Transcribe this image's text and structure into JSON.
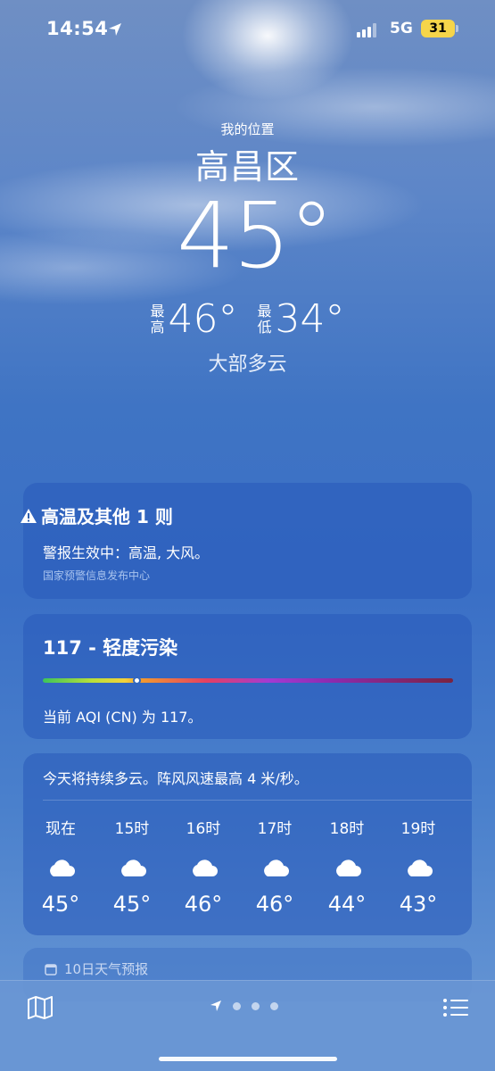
{
  "status_bar": {
    "time": "14:54",
    "network": "5G",
    "battery": "31",
    "battery_color": "#f6d54a",
    "icons": [
      "location-arrow-icon",
      "signal-icon"
    ]
  },
  "header": {
    "my_location": "我的位置",
    "city": "高昌区",
    "temperature": "45°",
    "high_label_1": "最",
    "high_label_2": "高",
    "high": "46°",
    "low_label_1": "最",
    "low_label_2": "低",
    "low": "34°",
    "condition": "大部多云"
  },
  "alert": {
    "icon": "warning-icon",
    "title": "高温及其他 1 则",
    "body": "警报生效中：高温, 大风。",
    "source": "国家预警信息发布中心"
  },
  "aqi": {
    "title": "117 - 轻度污染",
    "description": "当前 AQI (CN) 为 117。",
    "value": 117,
    "level_fraction": 0.23
  },
  "hourly": {
    "summary": "今天将持续多云。阵风风速最高 4 米/秒。",
    "hours": [
      {
        "label": "现在",
        "icon": "cloud-icon",
        "temp": "45°"
      },
      {
        "label": "15时",
        "icon": "cloud-icon",
        "temp": "45°"
      },
      {
        "label": "16时",
        "icon": "cloud-icon",
        "temp": "46°"
      },
      {
        "label": "17时",
        "icon": "cloud-icon",
        "temp": "46°"
      },
      {
        "label": "18时",
        "icon": "cloud-icon",
        "temp": "44°"
      },
      {
        "label": "19时",
        "icon": "cloud-icon",
        "temp": "43°"
      }
    ]
  },
  "forecast": {
    "icon": "calendar-icon",
    "title": "10日天气预报"
  },
  "toolbar": {
    "map_icon": "map-icon",
    "list_icon": "list-icon",
    "page_count": 3,
    "current_page": "location"
  }
}
